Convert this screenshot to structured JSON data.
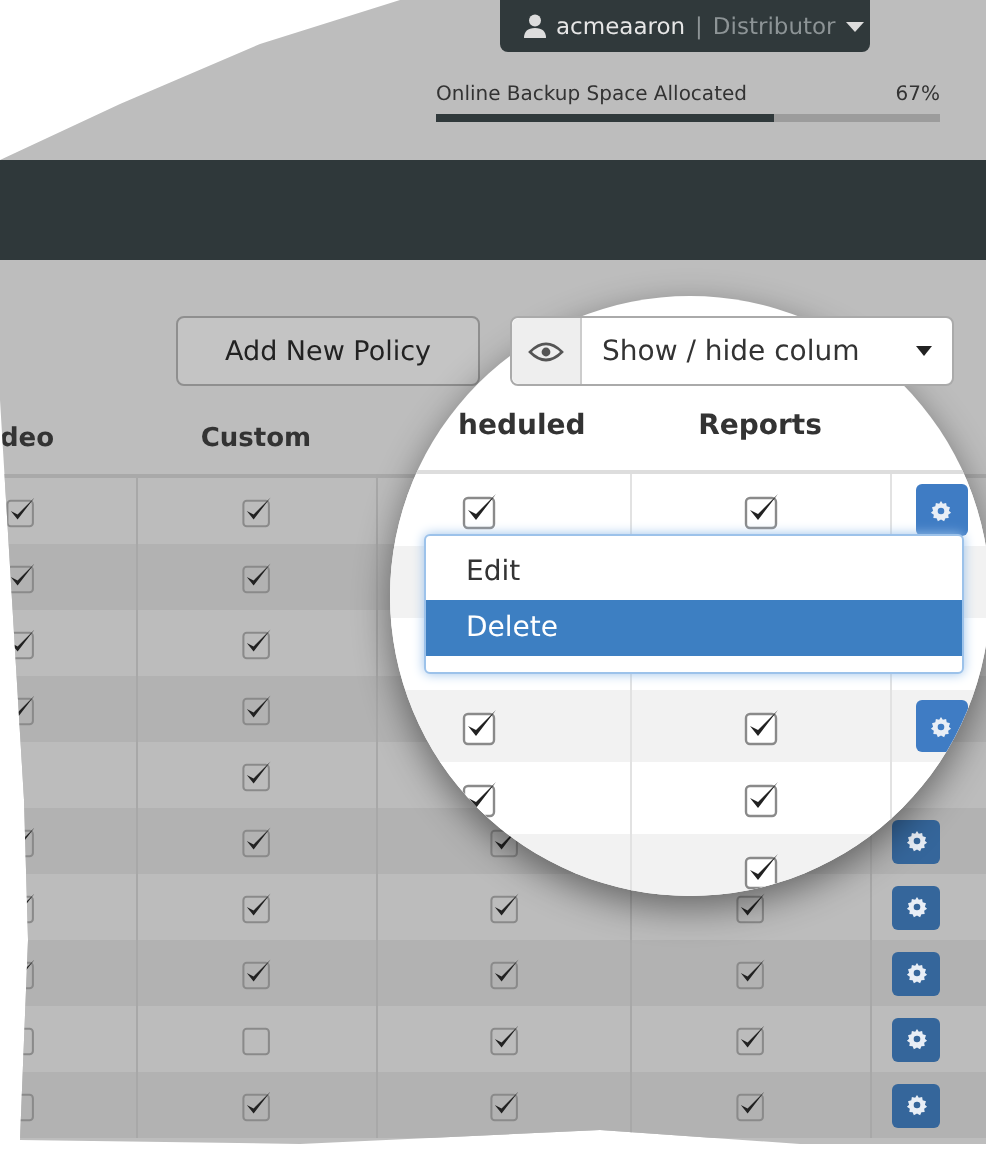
{
  "user_menu": {
    "username": "acmeaaron",
    "separator": "|",
    "role": "Distributor"
  },
  "storage": {
    "label": "Online Backup Space Allocated",
    "reading": "67%",
    "level": 0.67
  },
  "toolbar": {
    "add_button": "Add New Policy",
    "column_toggle": "Show / hide colum"
  },
  "table": {
    "columns": [
      "deo",
      "Custom"
    ],
    "rows": [
      {
        "column_1": true,
        "column_2": true
      },
      {
        "column_1": true,
        "column_2": true
      },
      {
        "column_1": true,
        "column_2": true
      },
      {
        "column_1": true,
        "column_2": true
      },
      {
        "column_2": true
      },
      {
        "column_1": true,
        "column_2": true,
        "column_3": true,
        "gear": true
      },
      {
        "column_1": true,
        "column_2": true,
        "column_3": true,
        "column_4": true,
        "gear": true
      },
      {
        "column_1": true,
        "column_2": true,
        "column_3": true,
        "column_4": true,
        "gear": true
      },
      {
        "column_1": false,
        "column_2": false,
        "column_3": true,
        "column_4": true,
        "gear": true
      },
      {
        "column_1": false,
        "column_2": true,
        "column_3": true,
        "column_4": true,
        "gear": true
      }
    ]
  },
  "magnifier": {
    "columns": [
      "heduled",
      "Reports"
    ],
    "rows": [
      {
        "column_3": true,
        "column_4": true,
        "gear": true
      },
      {},
      {},
      {
        "column_3": true,
        "column_4": true,
        "gear": true
      },
      {
        "column_3": true,
        "column_4": true
      },
      {
        "column_4": true
      }
    ],
    "menu": [
      {
        "label": "Edit",
        "selected": false
      },
      {
        "label": "Delete",
        "selected": true
      }
    ]
  }
}
